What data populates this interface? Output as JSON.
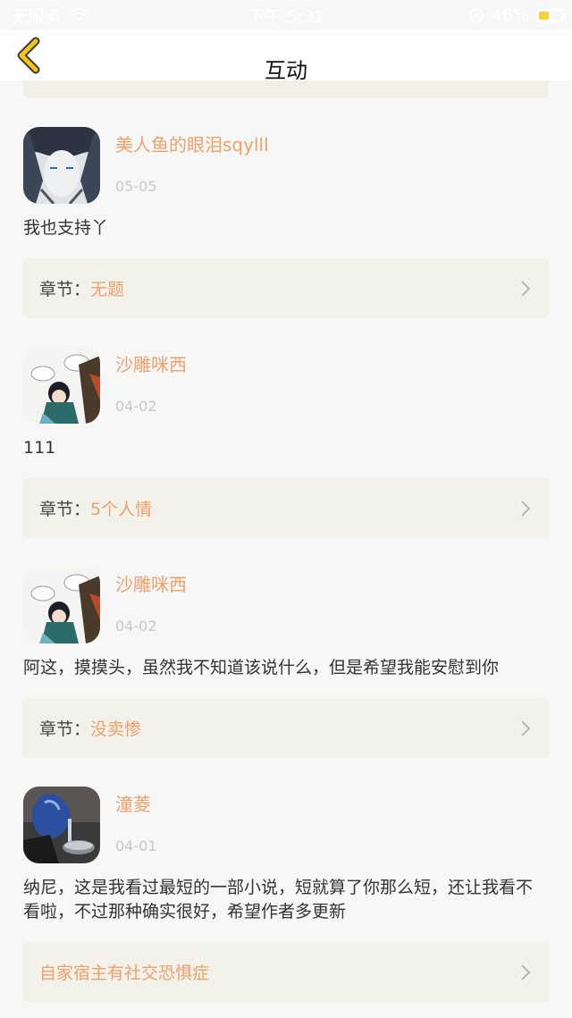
{
  "status_bar": {
    "carrier": "无服务",
    "time": "下午 5:31",
    "battery": "46%",
    "battery_level": 0.46
  },
  "nav": {
    "title": "互动",
    "back_icon": "chevron-left-icon",
    "accent": "#f0c419"
  },
  "colors": {
    "username": "#f0a06a",
    "chapter_bg": "#f2f1ea",
    "background": "#f7f7f7"
  },
  "comments": [
    {
      "username": "美人鱼的眼泪sqylll",
      "date": "05-05",
      "text": "我也支持丫",
      "chapter_label": "章节：",
      "chapter_name": "无题"
    },
    {
      "username": "沙雕咪西",
      "date": "04-02",
      "text": "111",
      "chapter_label": "章节：",
      "chapter_name": "5个人情"
    },
    {
      "username": "沙雕咪西",
      "date": "04-02",
      "text": "阿这，摸摸头，虽然我不知道该说什么，但是希望我能安慰到你",
      "chapter_label": "章节：",
      "chapter_name": "没卖惨"
    },
    {
      "username": "潼菱",
      "date": "04-01",
      "text": "纳尼，这是我看过最短的一部小说，短就算了你那么短，还让我看不看啦，不过那种确实很好，希望作者多更新",
      "chapter_label": "",
      "chapter_name": "自家宿主有社交恐惧症"
    }
  ]
}
